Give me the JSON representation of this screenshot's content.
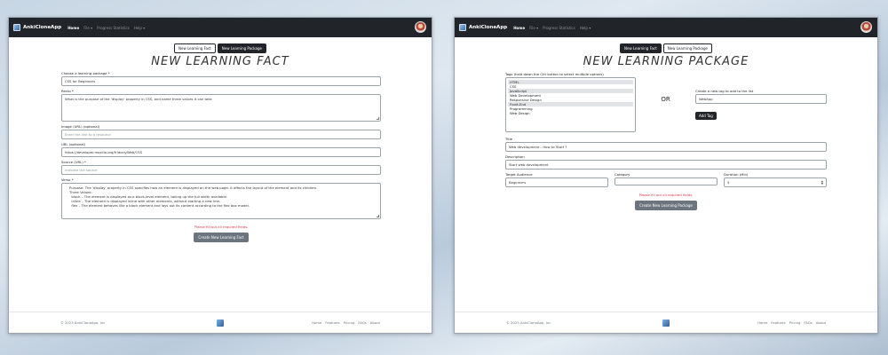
{
  "nav": {
    "brand": "AnkiCloneApp",
    "links": [
      "Home",
      "File ▾",
      "Progress Statistics",
      "Help ▾"
    ]
  },
  "toggle": {
    "fact_label": "New Learning Fact",
    "package_label": "New Learning Package"
  },
  "fact": {
    "title": "NEW LEARNING FACT",
    "package_label": "Choose a learning package *",
    "package_value": "CSS for Beginners",
    "recto_label": "Recto *",
    "recto_value": "What is the purpose of the 'display' property in CSS, and name three values it can take",
    "image_label": "Image (URL) (optional)",
    "image_placeholder": "Enter the link to a resource",
    "url_label": "URL (optional)",
    "url_value": "https://developer.mozilla.org/fr/docs/Web/CSS",
    "source_label": "Source (URL) *",
    "source_placeholder": "Indicate the source",
    "verso_label": "Verso *",
    "verso_value": "Purpose: The 'display' property in CSS specifies how an element is displayed on the web page. It affects the layout of the element and its children.\nThree Values:\n  block – The element is displayed as a block-level element, taking up the full width available.\n  inline – The element is displayed inline with other elements, without starting a new line.\n  flex – The element behaves like a block element and lays out its content according to the flex box model.",
    "error": "Please fill out all required fields.",
    "submit": "Create New Learning Fact"
  },
  "package": {
    "title": "NEW LEARNING PACKAGE",
    "tags_label": "Tags (hold down the Ctrl button to select multiple options)",
    "tags": [
      {
        "name": "HTML",
        "selected": true
      },
      {
        "name": "CSS",
        "selected": false
      },
      {
        "name": "JavaScript",
        "selected": true
      },
      {
        "name": "Web Development",
        "selected": false
      },
      {
        "name": "Responsive Design",
        "selected": false
      },
      {
        "name": "Front-End",
        "selected": true
      },
      {
        "name": "Programming",
        "selected": false
      },
      {
        "name": "Web Design",
        "selected": false
      }
    ],
    "or_label": "OR",
    "new_tag_label": "Create a new tag to add to the list",
    "new_tag_value": "WebApp",
    "add_tag": "Add Tag",
    "title_label": "Title",
    "title_value": "Web development - How to Start ?",
    "description_label": "Description",
    "description_value": "Start web development",
    "audience_label": "Target Audience",
    "audience_value": "Beginners",
    "category_label": "Category",
    "category_value": "",
    "duration_label": "Duration (Min)",
    "duration_value": "5",
    "error": "Please fill out all required fields.",
    "submit": "Create New Learning Package"
  },
  "footer": {
    "copyright": "© 2023 AnkiCloneApp, Inc",
    "links": [
      "Home",
      "Features",
      "Pricing",
      "FAQs",
      "About"
    ]
  }
}
